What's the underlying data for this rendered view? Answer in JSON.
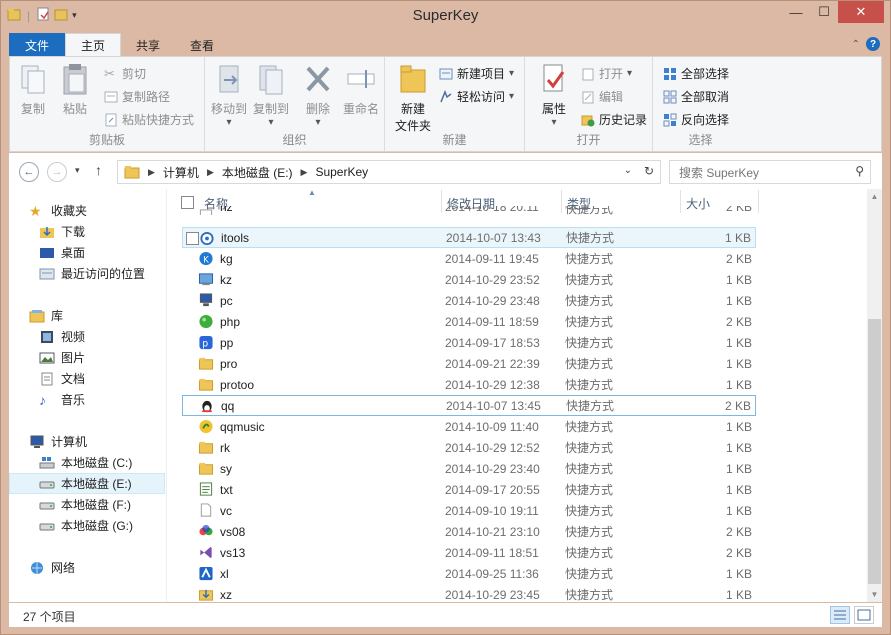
{
  "window": {
    "title": "SuperKey"
  },
  "ribbon_tabs": [
    {
      "label": "文件"
    },
    {
      "label": "主页"
    },
    {
      "label": "共享"
    },
    {
      "label": "查看"
    }
  ],
  "clipboard": {
    "copy": "复制",
    "paste": "粘贴",
    "cut": "剪切",
    "copy_path": "复制路径",
    "paste_shortcut": "粘贴快捷方式",
    "group": "剪贴板"
  },
  "organize": {
    "move_to": "移动到",
    "copy_to": "复制到",
    "delete": "删除",
    "rename": "重命名",
    "group": "组织"
  },
  "new": {
    "new_folder_line1": "新建",
    "new_folder_line2": "文件夹",
    "new_item": "新建项目",
    "easy_access": "轻松访问",
    "group": "新建"
  },
  "open": {
    "properties": "属性",
    "open": "打开",
    "edit": "编辑",
    "history": "历史记录",
    "group": "打开"
  },
  "select": {
    "select_all": "全部选择",
    "select_none": "全部取消",
    "invert": "反向选择",
    "group": "选择"
  },
  "address": {
    "seg1": "计算机",
    "seg2": "本地磁盘 (E:)",
    "seg3": "SuperKey"
  },
  "search": {
    "placeholder": "搜索 SuperKey"
  },
  "nav": {
    "favorites": "收藏夹",
    "downloads": "下载",
    "desktop": "桌面",
    "recent": "最近访问的位置",
    "libraries": "库",
    "videos": "视频",
    "pictures": "图片",
    "documents": "文档",
    "music": "音乐",
    "computer": "计算机",
    "drive_c": "本地磁盘 (C:)",
    "drive_e": "本地磁盘 (E:)",
    "drive_f": "本地磁盘 (F:)",
    "drive_g": "本地磁盘 (G:)",
    "network": "网络"
  },
  "columns": {
    "name": "名称",
    "date": "修改日期",
    "type": "类型",
    "size": "大小"
  },
  "files": [
    {
      "name": "hz",
      "date": "2014-10-18 20:11",
      "type": "快捷方式",
      "size": "2 KB",
      "icon": "shortcut-icon"
    },
    {
      "name": "itools",
      "date": "2014-10-07 13:43",
      "type": "快捷方式",
      "size": "1 KB",
      "icon": "itools-icon"
    },
    {
      "name": "kg",
      "date": "2014-09-11 19:45",
      "type": "快捷方式",
      "size": "2 KB",
      "icon": "kugou-icon"
    },
    {
      "name": "kz",
      "date": "2014-10-29 23:52",
      "type": "快捷方式",
      "size": "1 KB",
      "icon": "control-icon"
    },
    {
      "name": "pc",
      "date": "2014-10-29 23:48",
      "type": "快捷方式",
      "size": "1 KB",
      "icon": "computer-icon"
    },
    {
      "name": "php",
      "date": "2014-09-11 18:59",
      "type": "快捷方式",
      "size": "2 KB",
      "icon": "green-circle-icon"
    },
    {
      "name": "pp",
      "date": "2014-09-17 18:53",
      "type": "快捷方式",
      "size": "1 KB",
      "icon": "pp-icon"
    },
    {
      "name": "pro",
      "date": "2014-09-21 22:39",
      "type": "快捷方式",
      "size": "1 KB",
      "icon": "folder-icon"
    },
    {
      "name": "protoo",
      "date": "2014-10-29 12:38",
      "type": "快捷方式",
      "size": "1 KB",
      "icon": "folder-icon"
    },
    {
      "name": "qq",
      "date": "2014-10-07 13:45",
      "type": "快捷方式",
      "size": "2 KB",
      "icon": "qq-penguin-icon"
    },
    {
      "name": "qqmusic",
      "date": "2014-10-09 11:40",
      "type": "快捷方式",
      "size": "1 KB",
      "icon": "qqmusic-icon"
    },
    {
      "name": "rk",
      "date": "2014-10-29 12:52",
      "type": "快捷方式",
      "size": "1 KB",
      "icon": "folder-icon"
    },
    {
      "name": "sy",
      "date": "2014-10-29 23:40",
      "type": "快捷方式",
      "size": "1 KB",
      "icon": "folder-icon"
    },
    {
      "name": "txt",
      "date": "2014-09-17 20:55",
      "type": "快捷方式",
      "size": "1 KB",
      "icon": "notepad-icon"
    },
    {
      "name": "vc",
      "date": "2014-09-10 19:11",
      "type": "快捷方式",
      "size": "1 KB",
      "icon": "blank-file-icon"
    },
    {
      "name": "vs08",
      "date": "2014-10-21 23:10",
      "type": "快捷方式",
      "size": "2 KB",
      "icon": "vs08-icon"
    },
    {
      "name": "vs13",
      "date": "2014-09-11 18:51",
      "type": "快捷方式",
      "size": "2 KB",
      "icon": "vs13-icon"
    },
    {
      "name": "xl",
      "date": "2014-09-25 11:36",
      "type": "快捷方式",
      "size": "1 KB",
      "icon": "xunlei-icon"
    },
    {
      "name": "xz",
      "date": "2014-10-29 23:45",
      "type": "快捷方式",
      "size": "1 KB",
      "icon": "download-folder-icon"
    }
  ],
  "status": {
    "count": "27 个项目"
  },
  "colors": {
    "accent": "#1c6cc0",
    "frame": "#dcb9a5",
    "close": "#c7504b"
  }
}
